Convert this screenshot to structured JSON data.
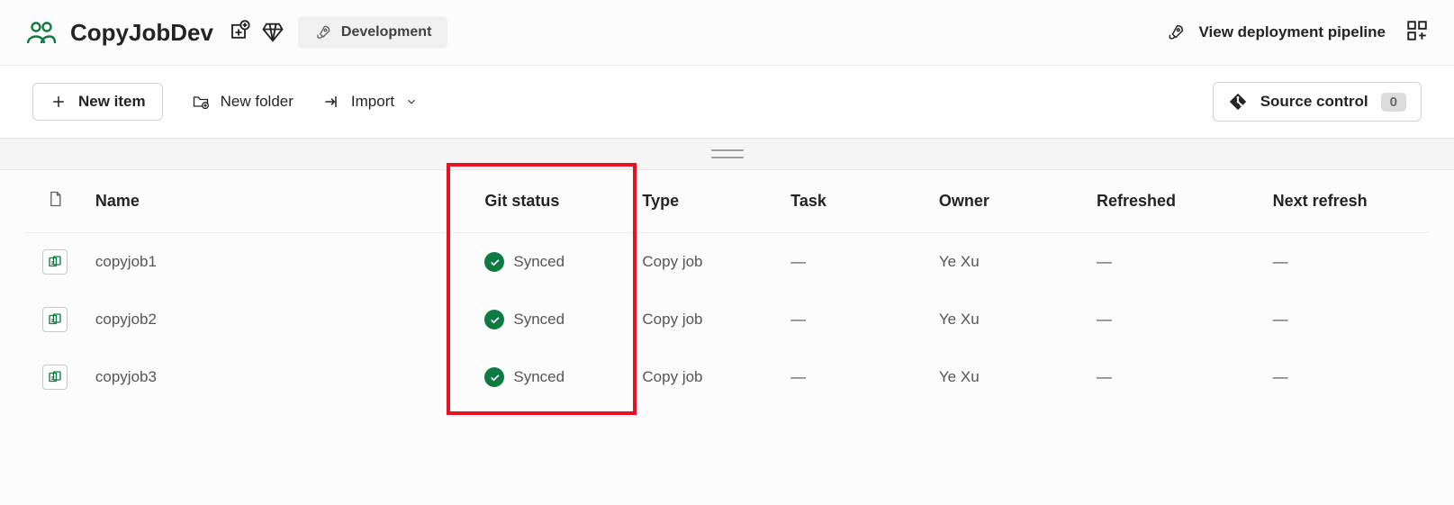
{
  "header": {
    "workspace_name": "CopyJobDev",
    "environment_label": "Development",
    "deploy_link": "View deployment pipeline"
  },
  "toolbar": {
    "new_item": "New item",
    "new_folder": "New folder",
    "import": "Import",
    "source_control": "Source control",
    "source_control_count": "0"
  },
  "columns": {
    "name": "Name",
    "git_status": "Git status",
    "type": "Type",
    "task": "Task",
    "owner": "Owner",
    "refreshed": "Refreshed",
    "next_refresh": "Next refresh"
  },
  "rows": [
    {
      "name": "copyjob1",
      "git_status": "Synced",
      "type": "Copy job",
      "task": "—",
      "owner": "Ye Xu",
      "refreshed": "—",
      "next_refresh": "—"
    },
    {
      "name": "copyjob2",
      "git_status": "Synced",
      "type": "Copy job",
      "task": "—",
      "owner": "Ye Xu",
      "refreshed": "—",
      "next_refresh": "—"
    },
    {
      "name": "copyjob3",
      "git_status": "Synced",
      "type": "Copy job",
      "task": "—",
      "owner": "Ye Xu",
      "refreshed": "—",
      "next_refresh": "—"
    }
  ]
}
